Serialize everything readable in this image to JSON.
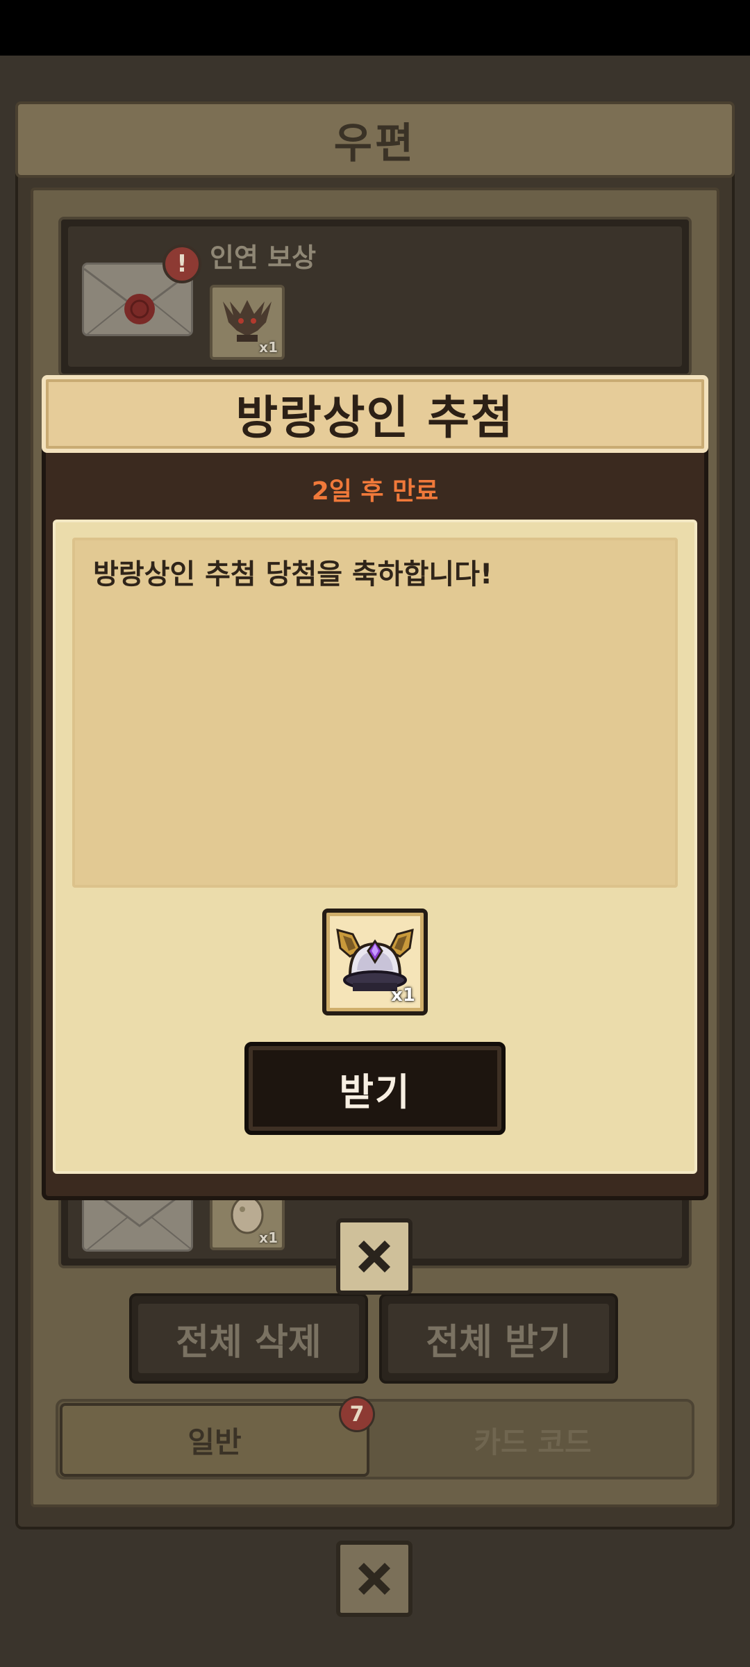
{
  "mailbox": {
    "title": "우편",
    "items": [
      {
        "name": "인연 보상",
        "count": "x1",
        "alert": "!"
      },
      {
        "name": "",
        "count": "x1"
      }
    ],
    "delete_all_label": "전체 삭제",
    "claim_all_label": "전체 받기",
    "tabs": [
      {
        "label": "일반",
        "badge": "7"
      },
      {
        "label": "카드 코드"
      }
    ]
  },
  "modal": {
    "title": "방랑상인 추첨",
    "expiry": "2일 후 만료",
    "message": "방랑상인 추첨 당첨을 축하합니다!",
    "reward": {
      "count": "x1",
      "icon": "horned-helmet-icon"
    },
    "claim_label": "받기"
  },
  "colors": {
    "expiry_text": "#f0793a",
    "paper": "#ebdcab",
    "title_bar": "#e6cc99",
    "button_dark": "#1d150f",
    "alert_red": "#8d3a33"
  }
}
